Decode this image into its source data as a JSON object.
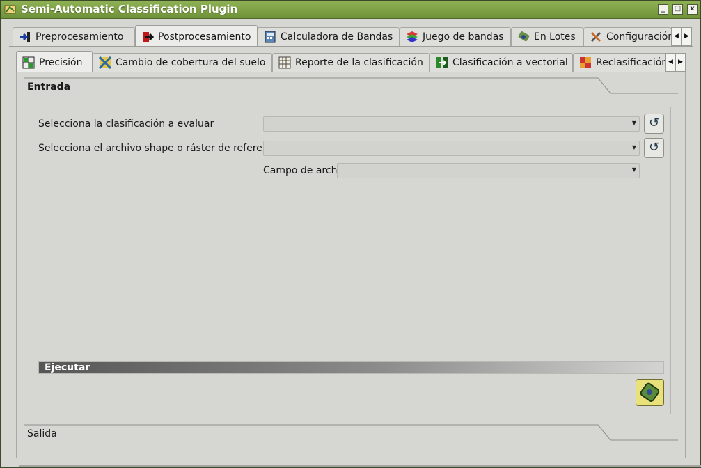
{
  "window": {
    "title": "Semi-Automatic Classification Plugin",
    "minimize": "_",
    "maximize": "□",
    "close": "x"
  },
  "main_tabs": [
    {
      "label": "Preprocesamiento",
      "icon": "arrow-in-icon"
    },
    {
      "label": "Postprocesamiento",
      "icon": "arrow-out-icon"
    },
    {
      "label": "Calculadora de Bandas",
      "icon": "calculator-icon"
    },
    {
      "label": "Juego de bandas",
      "icon": "layers-icon"
    },
    {
      "label": "En Lotes",
      "icon": "batch-icon"
    },
    {
      "label": "Configuración",
      "icon": "tools-icon"
    }
  ],
  "sub_tabs": [
    {
      "label": "Precisión",
      "icon": "accuracy-icon"
    },
    {
      "label": "Cambio de cobertura del suelo",
      "icon": "land-cover-change-icon"
    },
    {
      "label": "Reporte de la clasificación",
      "icon": "report-icon"
    },
    {
      "label": "Clasificación a vectorial",
      "icon": "vector-icon"
    },
    {
      "label": "Reclasificación",
      "icon": "reclassify-icon"
    }
  ],
  "input_section": {
    "title": "Entrada",
    "select_classification_label": "Selecciona la clasificación a evaluar",
    "select_classification_value": "",
    "select_reference_label": "Selecciona el archivo shape o ráster de referencia",
    "select_reference_value": "",
    "field_label": "Campo de archi",
    "field_value": ""
  },
  "run_section": {
    "title": "Ejecutar"
  },
  "output_section": {
    "title": "Salida"
  },
  "colors": {
    "titlebar": "#7fa347",
    "background": "#d6d7d2",
    "run_button": "#e9e17a"
  }
}
